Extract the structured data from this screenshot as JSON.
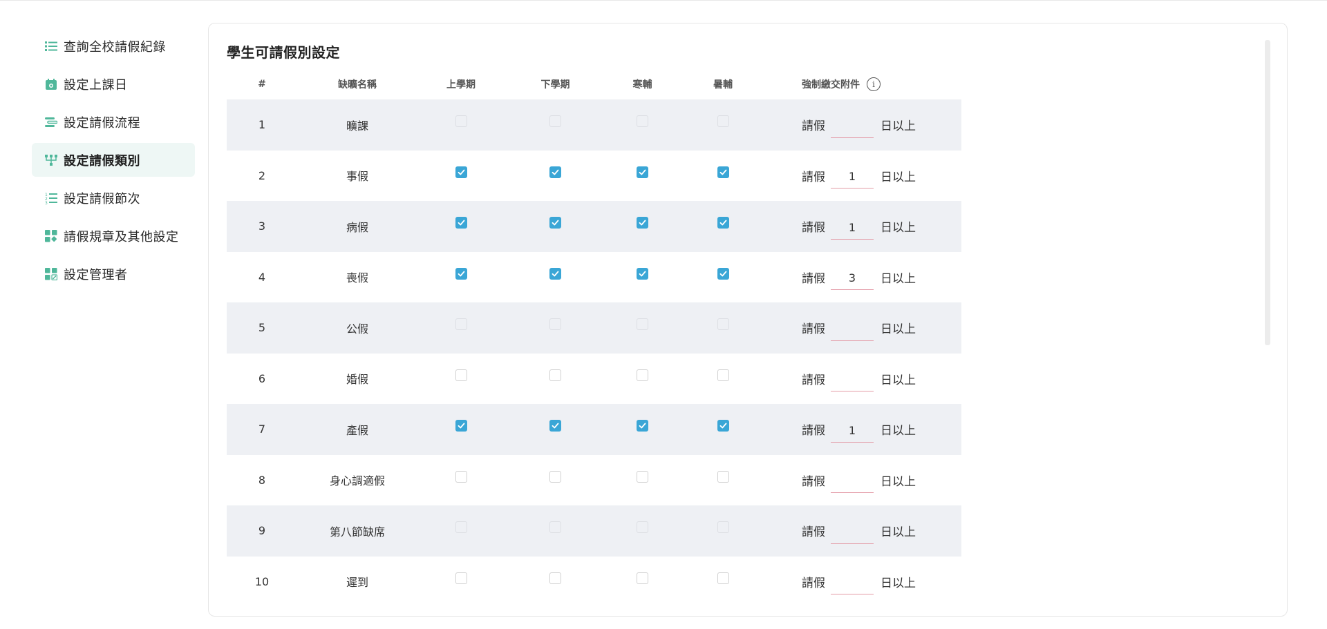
{
  "sidebar": {
    "items": [
      {
        "label": "查詢全校請假紀錄",
        "icon": "list-icon",
        "active": false
      },
      {
        "label": "設定上課日",
        "icon": "calendar-icon",
        "active": false
      },
      {
        "label": "設定請假流程",
        "icon": "flow-icon",
        "active": false
      },
      {
        "label": "設定請假類別",
        "icon": "category-icon",
        "active": true
      },
      {
        "label": "設定請假節次",
        "icon": "numbered-list-icon",
        "active": false
      },
      {
        "label": "請假規章及其他設定",
        "icon": "widgets-icon",
        "active": false
      },
      {
        "label": "設定管理者",
        "icon": "admin-icon",
        "active": false
      }
    ]
  },
  "colors": {
    "accent": "#4fb79a",
    "checkbox": "#3aa6d6",
    "row_shade": "#eef0f4",
    "active_bg": "#eef7f5",
    "input_underline": "#e39aa6"
  },
  "main": {
    "title": "學生可請假別設定",
    "headers": {
      "num": "#",
      "name": "缺曠名稱",
      "first_term": "上學期",
      "second_term": "下學期",
      "winter": "寒輔",
      "summer": "暑輔",
      "attachment": "強制繳交附件"
    },
    "attachment_prefix": "請假",
    "attachment_suffix": "日以上",
    "rows": [
      {
        "num": "1",
        "name": "曠課",
        "checks": [
          "disabled",
          "disabled",
          "disabled",
          "disabled"
        ],
        "days": ""
      },
      {
        "num": "2",
        "name": "事假",
        "checks": [
          "checked",
          "checked",
          "checked",
          "checked"
        ],
        "days": "1"
      },
      {
        "num": "3",
        "name": "病假",
        "checks": [
          "checked",
          "checked",
          "checked",
          "checked"
        ],
        "days": "1"
      },
      {
        "num": "4",
        "name": "喪假",
        "checks": [
          "checked",
          "checked",
          "checked",
          "checked"
        ],
        "days": "3"
      },
      {
        "num": "5",
        "name": "公假",
        "checks": [
          "disabled",
          "disabled",
          "disabled",
          "disabled"
        ],
        "days": ""
      },
      {
        "num": "6",
        "name": "婚假",
        "checks": [
          "unchecked",
          "unchecked",
          "unchecked",
          "unchecked"
        ],
        "days": ""
      },
      {
        "num": "7",
        "name": "產假",
        "checks": [
          "checked",
          "checked",
          "checked",
          "checked"
        ],
        "days": "1"
      },
      {
        "num": "8",
        "name": "身心調適假",
        "checks": [
          "unchecked",
          "unchecked",
          "unchecked",
          "unchecked"
        ],
        "days": ""
      },
      {
        "num": "9",
        "name": "第八節缺席",
        "checks": [
          "disabled",
          "disabled",
          "disabled",
          "disabled"
        ],
        "days": ""
      },
      {
        "num": "10",
        "name": "遲到",
        "checks": [
          "unchecked",
          "unchecked",
          "unchecked",
          "unchecked"
        ],
        "days": ""
      }
    ]
  }
}
